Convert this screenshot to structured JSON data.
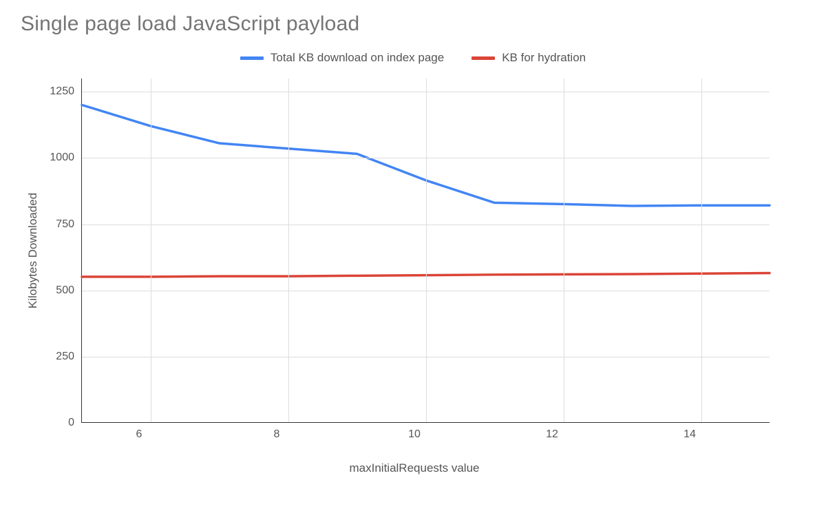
{
  "chart_data": {
    "type": "line",
    "title": "Single page load JavaScript payload",
    "xlabel": "maxInitialRequests value",
    "ylabel": "Kilobytes Downloaded",
    "x": [
      5,
      6,
      7,
      8,
      9,
      10,
      11,
      12,
      13,
      14,
      15
    ],
    "x_ticks": [
      6,
      8,
      10,
      12,
      14
    ],
    "y_ticks": [
      0,
      250,
      500,
      750,
      1000,
      1250
    ],
    "xlim": [
      5,
      15
    ],
    "ylim": [
      0,
      1300
    ],
    "series": [
      {
        "name": "Total KB download on index page",
        "color": "#4285f4",
        "values": [
          1200,
          1120,
          1055,
          1035,
          1015,
          915,
          830,
          825,
          818,
          820,
          820
        ]
      },
      {
        "name": "KB for hydration",
        "color": "#db4437",
        "values": [
          550,
          550,
          552,
          552,
          554,
          556,
          558,
          559,
          560,
          562,
          564
        ]
      }
    ],
    "legend_position": "top"
  }
}
